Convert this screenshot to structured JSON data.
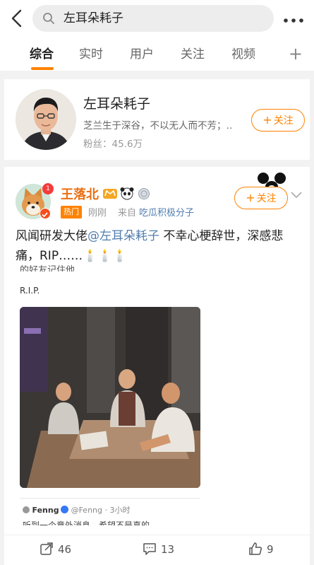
{
  "search": {
    "query": "左耳朵耗子"
  },
  "tabs": [
    {
      "label": "综合",
      "active": true
    },
    {
      "label": "实时"
    },
    {
      "label": "用户"
    },
    {
      "label": "关注"
    },
    {
      "label": "视频"
    }
  ],
  "user_card": {
    "name": "左耳朵耗子",
    "bio": "芝兰生于深谷，不以无人而不芳；‥",
    "fans": "粉丝：45.6万",
    "follow_label": "关注"
  },
  "post": {
    "author": "王落北",
    "notification_count": "1",
    "hot_tag": "热门",
    "time": "刚刚",
    "source_prefix": "来自",
    "source": "吃瓜积极分子",
    "follow_label": "关注",
    "text_before": "风闻研发大佬",
    "mention": "@左耳朵耗子",
    "text_after": " 不幸心梗辞世，深感悲痛，RIP……🕯️🕯️🕯️",
    "image_text_cropped": "的好友记住他",
    "image_text_rip": "R.I.P.",
    "quote": {
      "author": "Fenng",
      "handle": "@Fenng · 3小时",
      "body_cropped": "听到一个意外消息，希望不是真的"
    }
  },
  "actions": {
    "repost_count": "46",
    "comment_count": "13",
    "like_count": "9"
  },
  "colors": {
    "accent": "#ff8200",
    "link": "#507daf",
    "author_name": "#eb6f12"
  }
}
